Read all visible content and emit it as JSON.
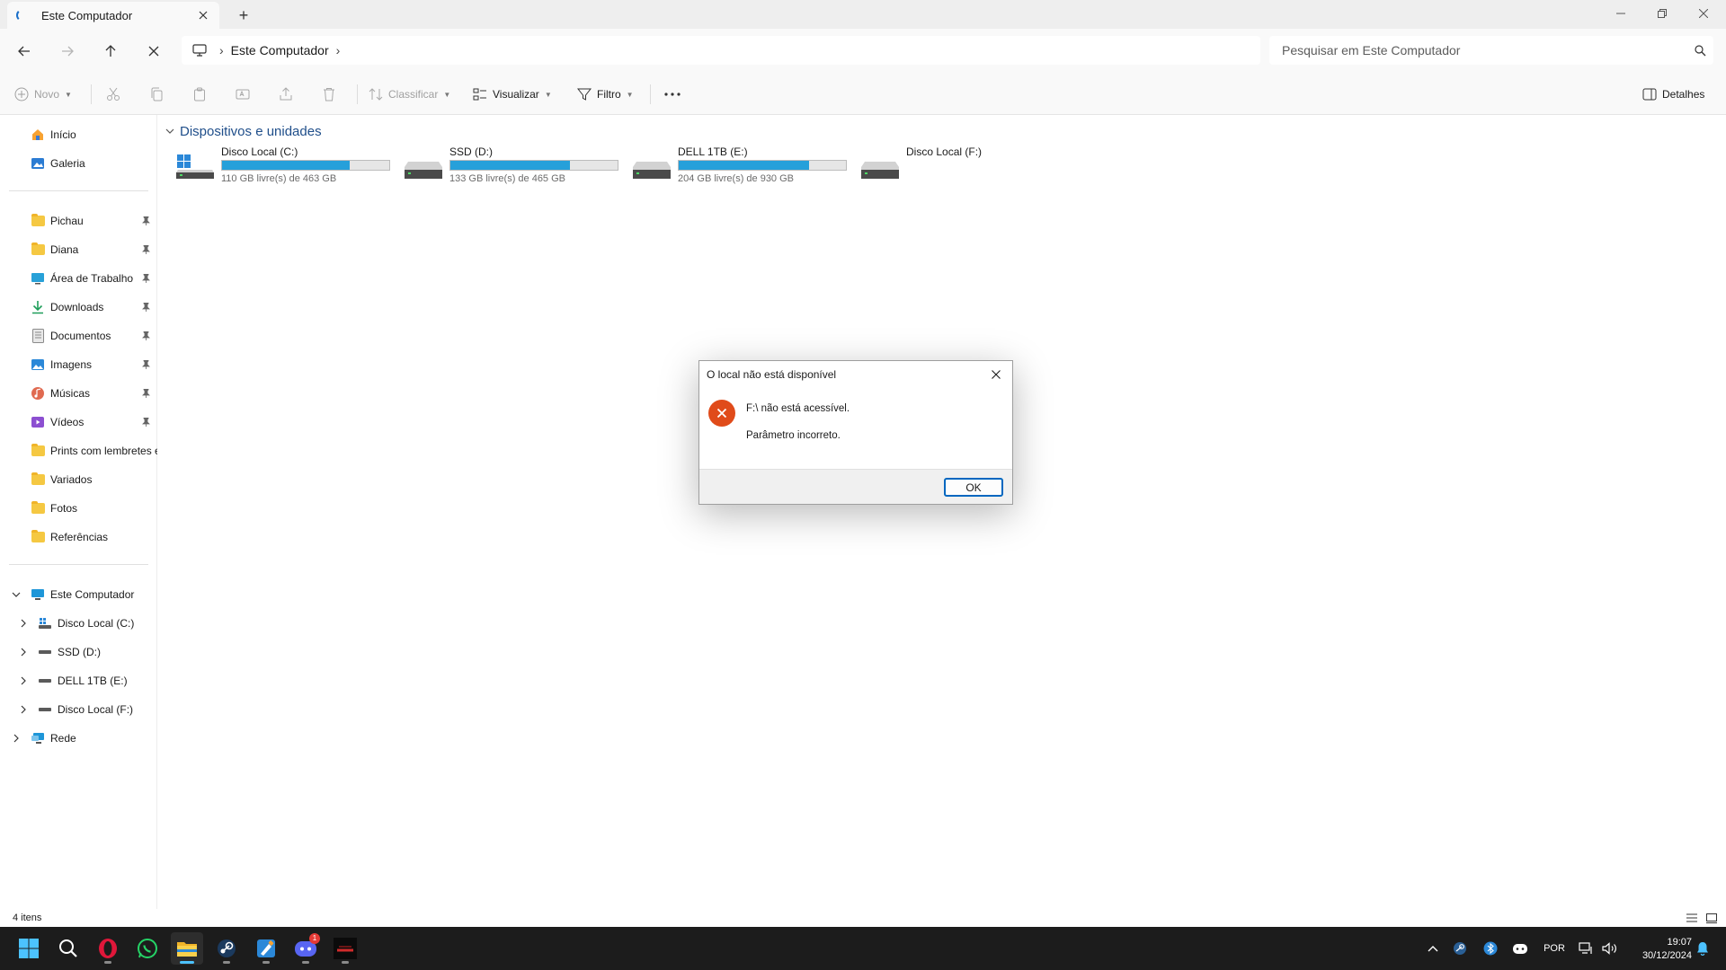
{
  "tab": {
    "title": "Este Computador",
    "new_tab_label": "+"
  },
  "address": {
    "crumbs": [
      "Este Computador"
    ]
  },
  "search": {
    "placeholder": "Pesquisar em Este Computador"
  },
  "commands": {
    "novo": "Novo",
    "classificar": "Classificar",
    "visualizar": "Visualizar",
    "filtro": "Filtro",
    "detalhes": "Detalhes"
  },
  "sidebar": {
    "top": [
      {
        "label": "Início",
        "icon": "home-icon"
      },
      {
        "label": "Galeria",
        "icon": "gallery-icon"
      }
    ],
    "pinned": [
      {
        "label": "Pichau",
        "icon": "folder-icon"
      },
      {
        "label": "Diana",
        "icon": "folder-icon"
      },
      {
        "label": "Área de Trabalho",
        "icon": "desktop-icon"
      },
      {
        "label": "Downloads",
        "icon": "download-icon"
      },
      {
        "label": "Documentos",
        "icon": "document-icon"
      },
      {
        "label": "Imagens",
        "icon": "image-icon"
      },
      {
        "label": "Músicas",
        "icon": "music-icon"
      },
      {
        "label": "Vídeos",
        "icon": "video-icon"
      }
    ],
    "folders": [
      {
        "label": "Prints com lembretes e",
        "icon": "folder-icon"
      },
      {
        "label": "Variados",
        "icon": "folder-icon"
      },
      {
        "label": "Fotos",
        "icon": "folder-icon"
      },
      {
        "label": "Referências",
        "icon": "folder-icon"
      }
    ],
    "tree": {
      "computer": "Este Computador",
      "drives": [
        "Disco Local (C:)",
        "SSD (D:)",
        "DELL 1TB (E:)",
        "Disco Local (F:)"
      ],
      "network": "Rede"
    }
  },
  "content": {
    "group_title": "Dispositivos e unidades",
    "drives": [
      {
        "name": "Disco Local (C:)",
        "free_text": "110 GB livre(s) de 463 GB",
        "used_fraction": 0.762,
        "windows": true
      },
      {
        "name": "SSD (D:)",
        "free_text": "133 GB livre(s) de 465 GB",
        "used_fraction": 0.714,
        "windows": false
      },
      {
        "name": "DELL 1TB (E:)",
        "free_text": "204 GB livre(s) de 930 GB",
        "used_fraction": 0.781,
        "windows": false
      },
      {
        "name": "Disco Local (F:)",
        "free_text": "",
        "used_fraction": null,
        "windows": false
      }
    ]
  },
  "status": {
    "count": "4 itens"
  },
  "dialog": {
    "title": "O local não está disponível",
    "message1": "F:\\ não está acessível.",
    "message2": "Parâmetro incorreto.",
    "ok_label": "OK"
  },
  "taskbar": {
    "discord_badge": "1",
    "language": "POR",
    "time": "19:07",
    "date": "30/12/2024"
  },
  "colors": {
    "accent": "#0067c0",
    "drive_bar": "#26a0da",
    "error": "#e04b1a",
    "taskbar": "#1c1c1c"
  }
}
